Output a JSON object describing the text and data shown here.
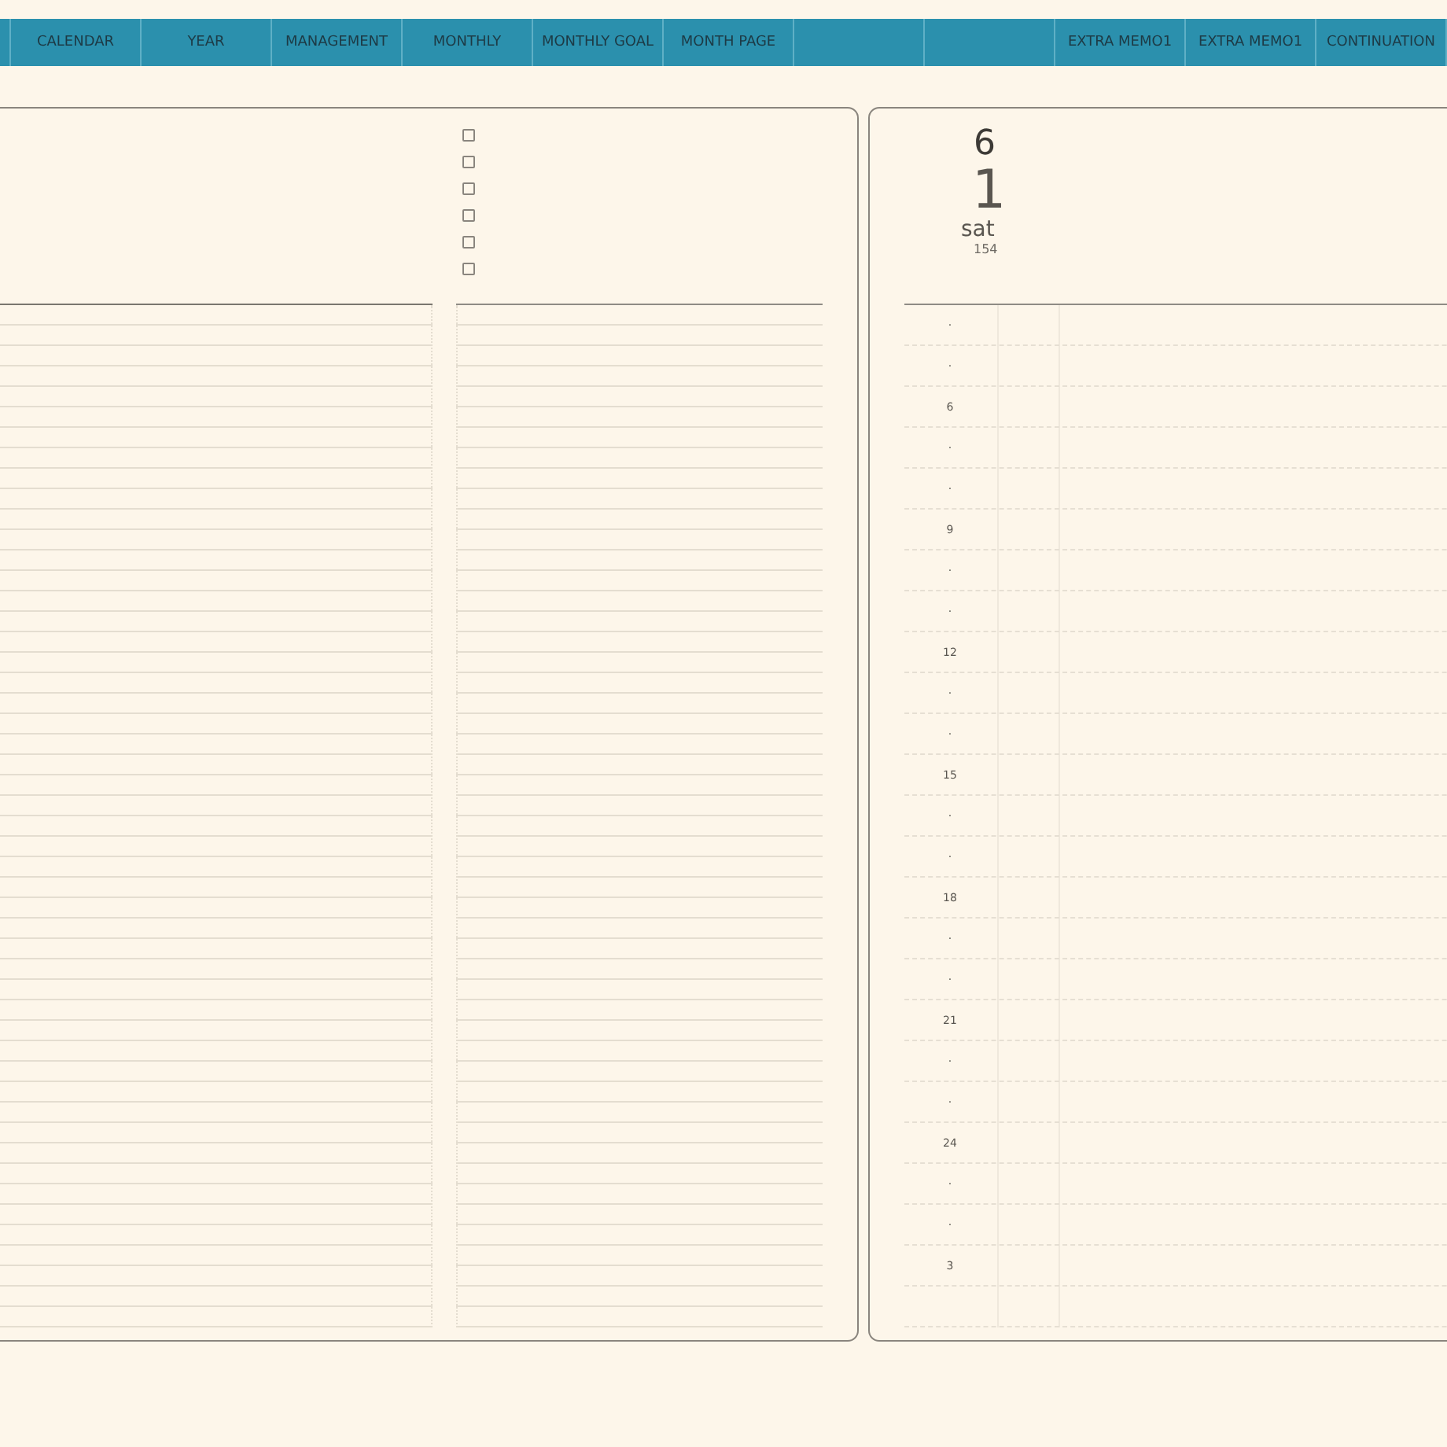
{
  "nav_tabs": [
    {
      "kind": "stub"
    },
    {
      "kind": "text",
      "label": "CALENDAR"
    },
    {
      "kind": "text",
      "label": "YEAR"
    },
    {
      "kind": "text",
      "label": "MANAGEMENT"
    },
    {
      "kind": "text",
      "label": "MONTHLY"
    },
    {
      "kind": "text",
      "label": "MONTHLY GOAL"
    },
    {
      "kind": "text",
      "label": "MONTH PAGE"
    },
    {
      "kind": "blank"
    },
    {
      "kind": "blank"
    },
    {
      "kind": "text",
      "label": "EXTRA MEMO1"
    },
    {
      "kind": "text",
      "label": "EXTRA MEMO1"
    },
    {
      "kind": "text",
      "label": "CONTINUATION"
    }
  ],
  "left_page": {
    "checklist": [
      {
        "checked": false
      },
      {
        "checked": false
      },
      {
        "checked": false
      },
      {
        "checked": false
      },
      {
        "checked": false
      },
      {
        "checked": false
      }
    ]
  },
  "right_page": {
    "month": "6",
    "day": "1",
    "weekday": "sat",
    "day_of_year": "154",
    "hours": [
      "·",
      "·",
      "6",
      "·",
      "·",
      "9",
      "·",
      "·",
      "12",
      "·",
      "·",
      "15",
      "·",
      "·",
      "18",
      "·",
      "·",
      "21",
      "·",
      "·",
      "24",
      "·",
      "·",
      "3"
    ]
  }
}
